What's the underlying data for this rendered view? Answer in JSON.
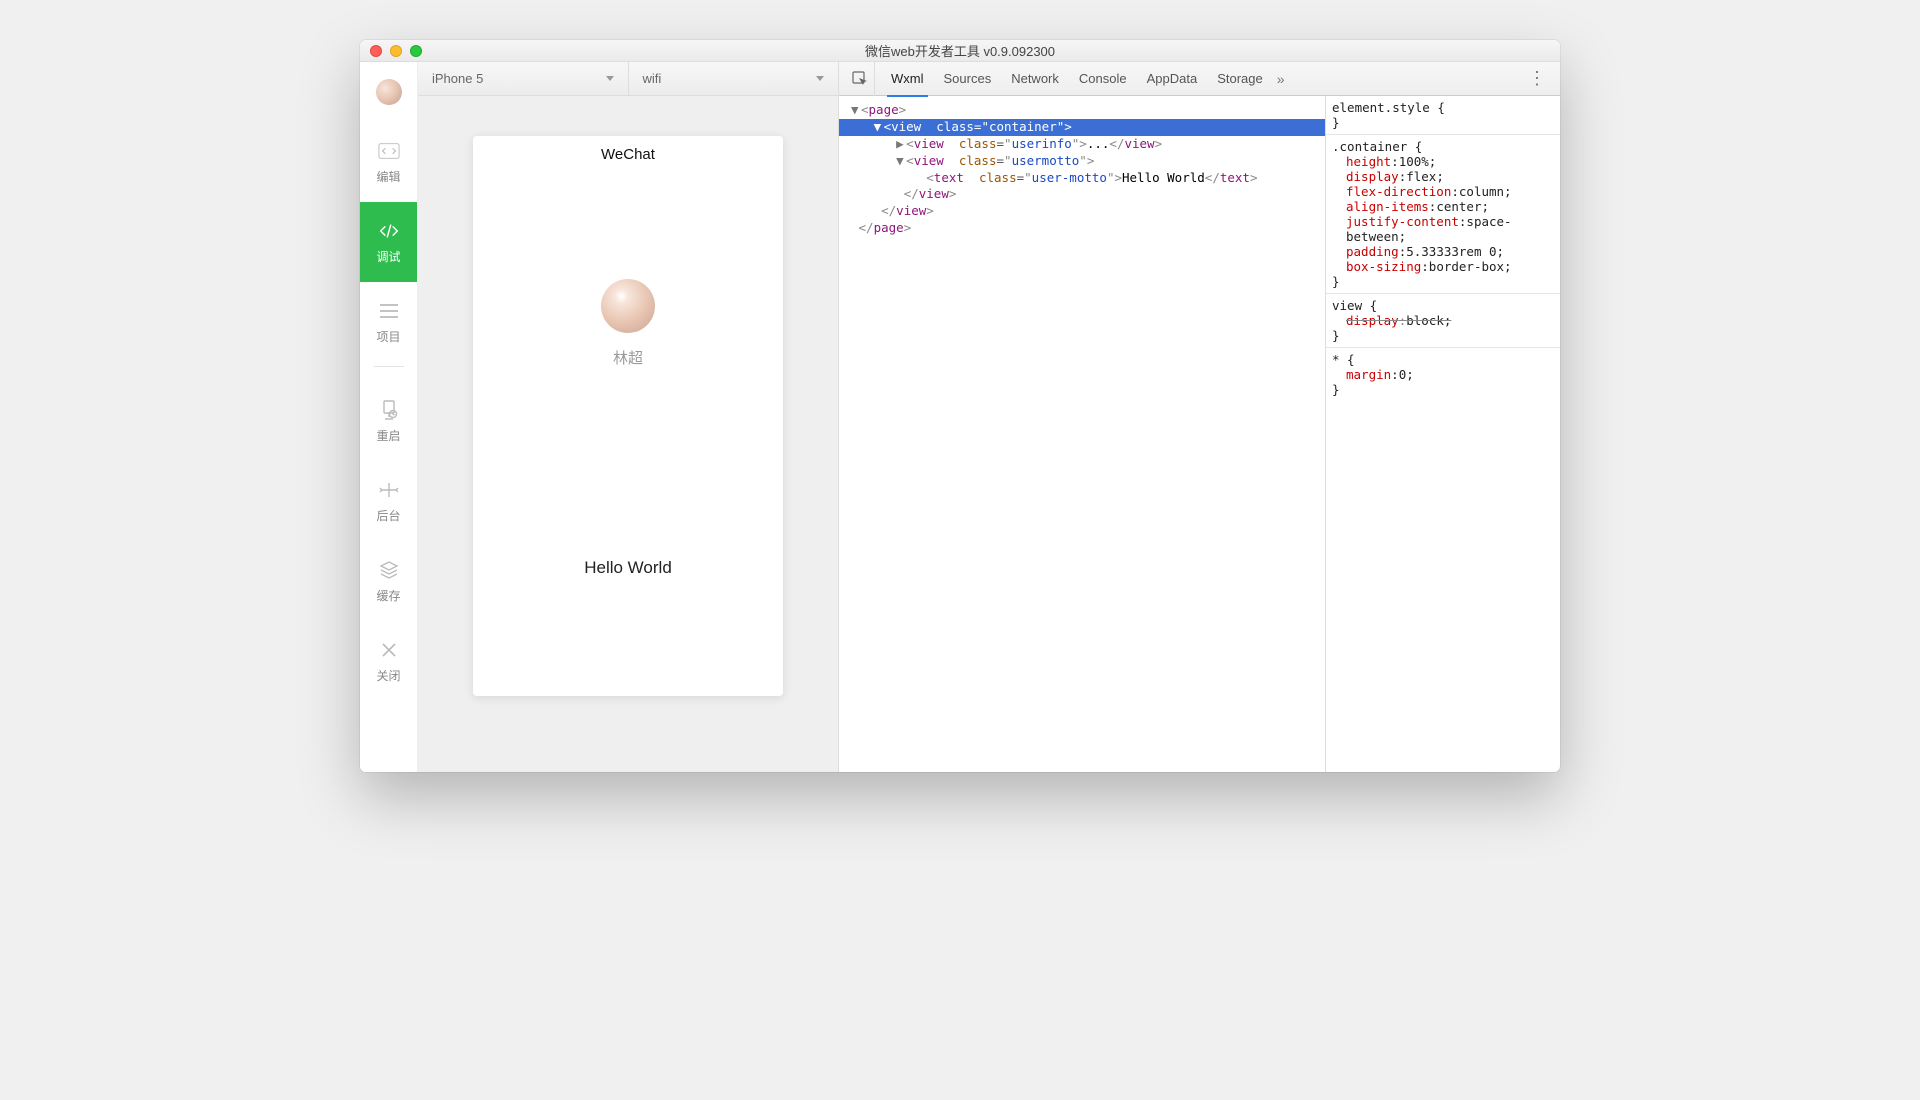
{
  "window": {
    "title": "微信web开发者工具 v0.9.092300"
  },
  "sidebar": {
    "items": [
      {
        "label": "编辑"
      },
      {
        "label": "调试"
      },
      {
        "label": "项目"
      },
      {
        "label": "重启"
      },
      {
        "label": "后台"
      },
      {
        "label": "缓存"
      },
      {
        "label": "关闭"
      }
    ]
  },
  "toolbar": {
    "device": "iPhone 5",
    "network": "wifi"
  },
  "preview": {
    "app_title": "WeChat",
    "user_name": "林超",
    "motto": "Hello World"
  },
  "devtools": {
    "tabs": [
      "Wxml",
      "Sources",
      "Network",
      "Console",
      "AppData",
      "Storage"
    ],
    "active_tab": "Wxml",
    "tree": {
      "page_tag": "page",
      "container": {
        "tag": "view",
        "class": "container"
      },
      "userinfo": {
        "tag": "view",
        "class": "userinfo",
        "ellipsis": "..."
      },
      "usermotto": {
        "tag": "view",
        "class": "usermotto"
      },
      "motto_text": {
        "tag": "text",
        "class": "user-motto",
        "text": "Hello World"
      }
    },
    "styles": {
      "element_style_selector": "element.style {",
      "container": {
        "selector": ".container {",
        "decls": [
          {
            "p": "height",
            "v": "100%;"
          },
          {
            "p": "display",
            "v": "flex;"
          },
          {
            "p": "flex-direction",
            "v": "column;"
          },
          {
            "p": "align-items",
            "v": "center;"
          },
          {
            "p": "justify-content",
            "v": "space-between;"
          },
          {
            "p": "padding",
            "v": "5.33333rem 0;"
          },
          {
            "p": "box-sizing",
            "v": "border-box;"
          }
        ]
      },
      "view": {
        "selector": "view {",
        "decls": [
          {
            "p": "display",
            "v": "block;",
            "struck": true
          }
        ]
      },
      "star": {
        "selector": "* {",
        "decls": [
          {
            "p": "margin",
            "v": "0;"
          }
        ]
      },
      "close": "}"
    }
  }
}
